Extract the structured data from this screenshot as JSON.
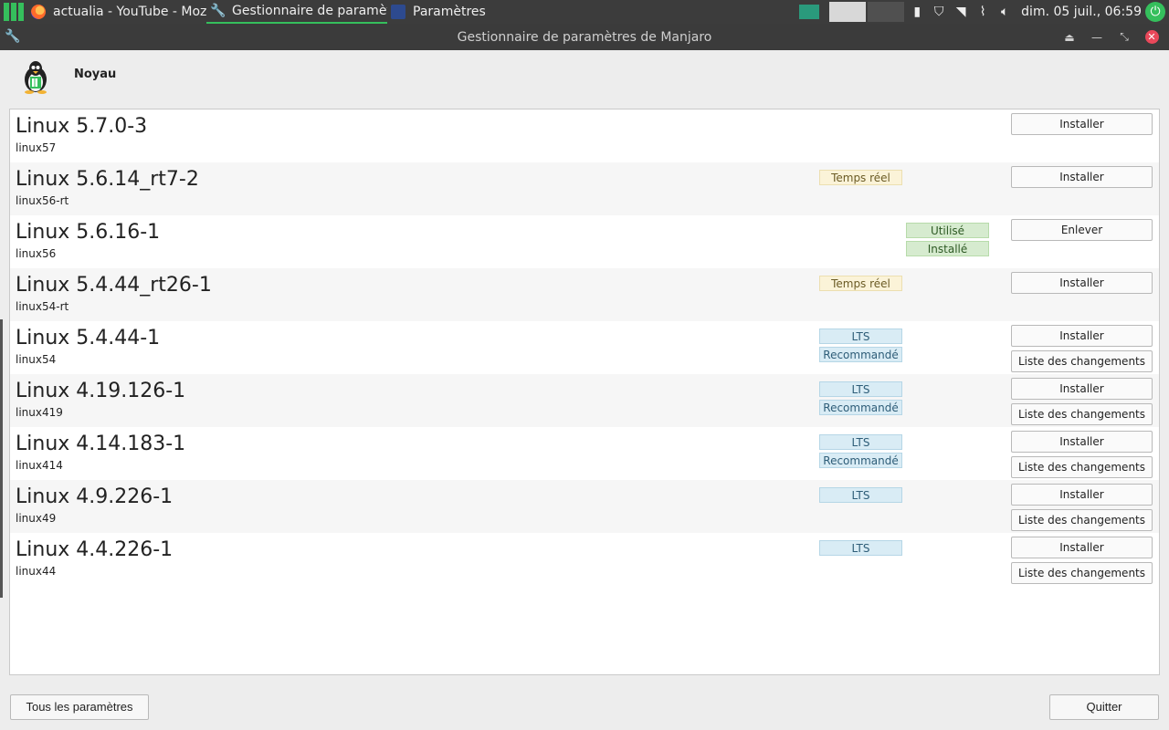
{
  "taskbar": {
    "tasks": [
      {
        "label": "actualia - YouTube - Mozill...",
        "icon": "firefox-icon"
      },
      {
        "label": "Gestionnaire de paramètr...",
        "icon": "wrench-icon"
      },
      {
        "label": "Paramètres",
        "icon": "settings-app-icon"
      }
    ],
    "clock": "dim. 05 juil., 06:59",
    "accent": "#35bf5c"
  },
  "window": {
    "title": "Gestionnaire de paramètres de Manjaro"
  },
  "header": {
    "title": "Noyau"
  },
  "kernels": [
    {
      "name": "Linux 5.7.0-3",
      "pkg": "linux57",
      "badges": [],
      "actions": [
        "Installer"
      ]
    },
    {
      "name": "Linux 5.6.14_rt7-2",
      "pkg": "linux56-rt",
      "badges": [
        {
          "text": "Temps réel",
          "kind": "rt"
        }
      ],
      "actions": [
        "Installer"
      ]
    },
    {
      "name": "Linux 5.6.16-1",
      "pkg": "linux56",
      "badges": [
        {
          "text": "Utilisé",
          "kind": "ok"
        },
        {
          "text": "Installé",
          "kind": "ok"
        }
      ],
      "actions": [
        "Enlever"
      ]
    },
    {
      "name": "Linux 5.4.44_rt26-1",
      "pkg": "linux54-rt",
      "badges": [
        {
          "text": "Temps réel",
          "kind": "rt"
        }
      ],
      "actions": [
        "Installer"
      ]
    },
    {
      "name": "Linux 5.4.44-1",
      "pkg": "linux54",
      "badges": [
        {
          "text": "LTS",
          "kind": "lts"
        },
        {
          "text": "Recommandé",
          "kind": "lts"
        }
      ],
      "actions": [
        "Installer",
        "Liste des changements"
      ]
    },
    {
      "name": "Linux 4.19.126-1",
      "pkg": "linux419",
      "badges": [
        {
          "text": "LTS",
          "kind": "lts"
        },
        {
          "text": "Recommandé",
          "kind": "lts"
        }
      ],
      "actions": [
        "Installer",
        "Liste des changements"
      ]
    },
    {
      "name": "Linux 4.14.183-1",
      "pkg": "linux414",
      "badges": [
        {
          "text": "LTS",
          "kind": "lts"
        },
        {
          "text": "Recommandé",
          "kind": "lts"
        }
      ],
      "actions": [
        "Installer",
        "Liste des changements"
      ]
    },
    {
      "name": "Linux 4.9.226-1",
      "pkg": "linux49",
      "badges": [
        {
          "text": "LTS",
          "kind": "lts"
        }
      ],
      "actions": [
        "Installer",
        "Liste des changements"
      ]
    },
    {
      "name": "Linux 4.4.226-1",
      "pkg": "linux44",
      "badges": [
        {
          "text": "LTS",
          "kind": "lts"
        }
      ],
      "actions": [
        "Installer",
        "Liste des changements"
      ]
    }
  ],
  "footer": {
    "all_settings": "Tous les paramètres",
    "quit": "Quitter"
  }
}
